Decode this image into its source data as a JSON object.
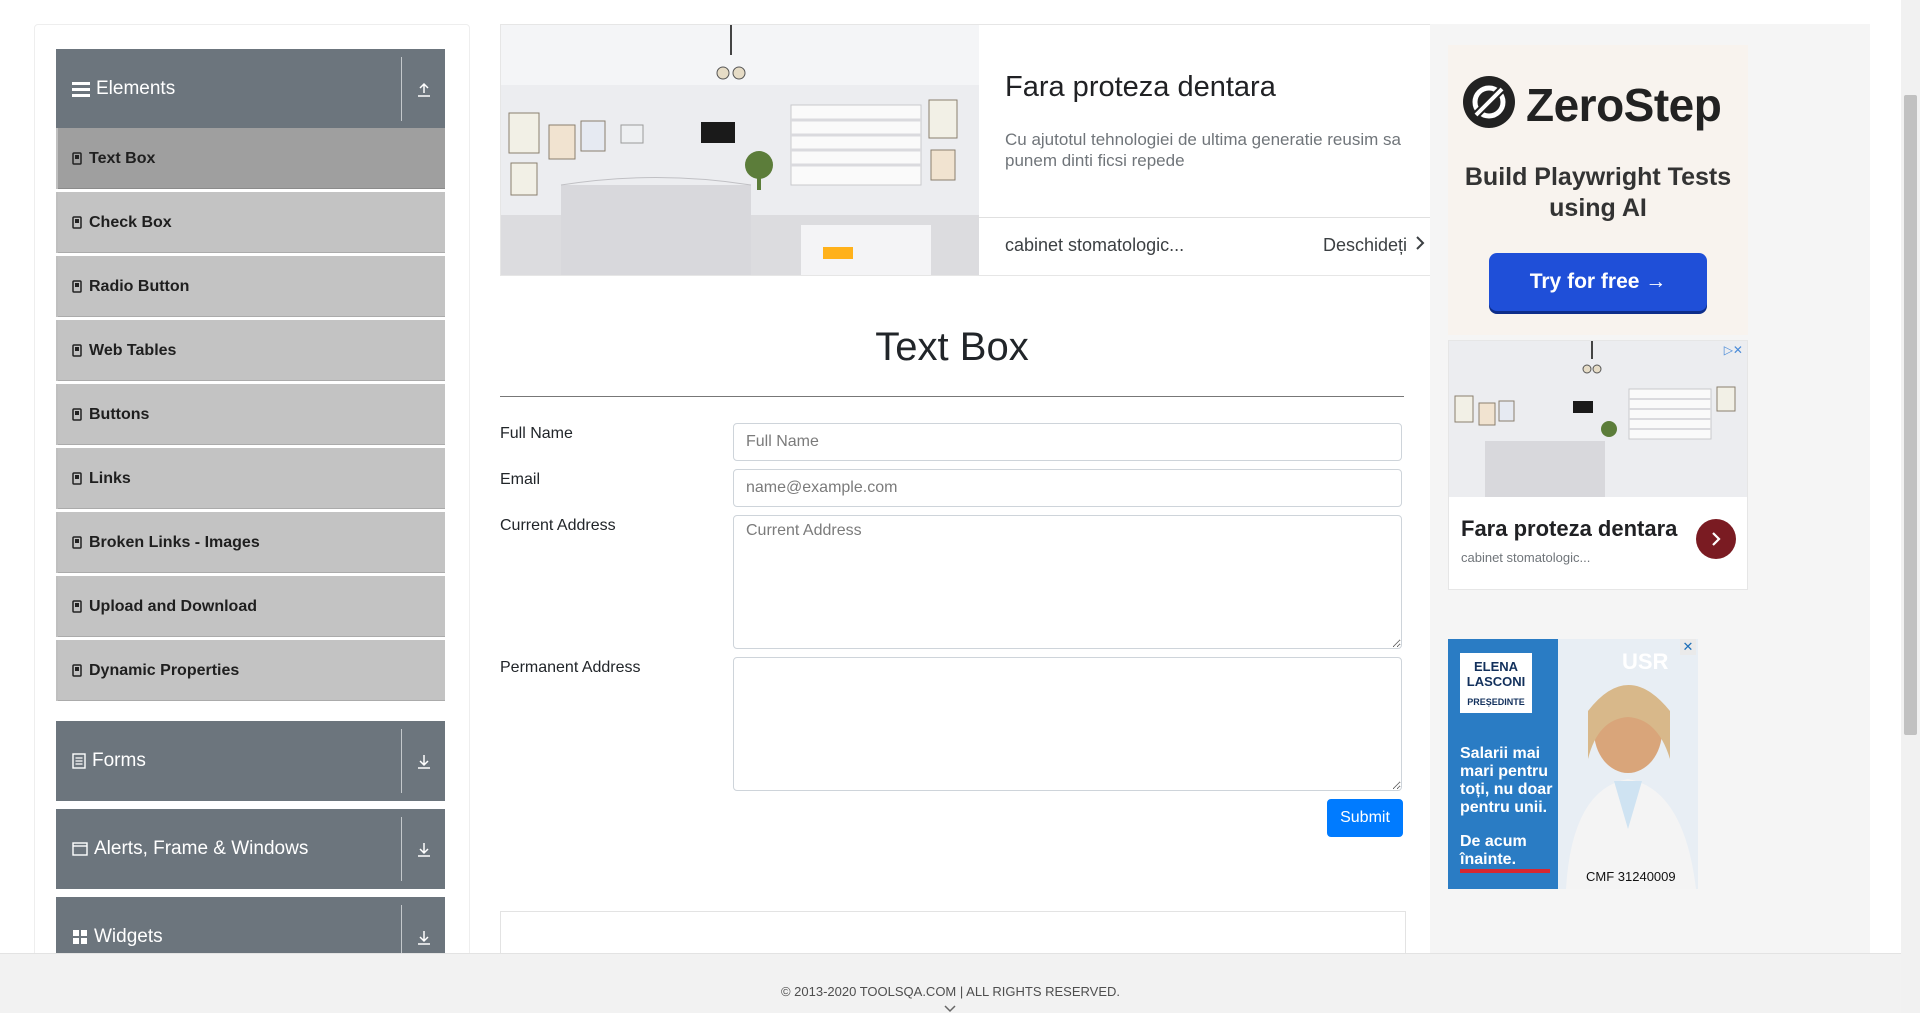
{
  "sidebar": {
    "groups": [
      {
        "label": "Elements",
        "icon": "hamburger-icon",
        "toggle": "collapse-up-icon"
      },
      {
        "label": "Forms",
        "icon": "document-icon",
        "toggle": "expand-down-icon"
      },
      {
        "label": "Alerts, Frame & Windows",
        "icon": "window-icon",
        "toggle": "expand-down-icon"
      },
      {
        "label": "Widgets",
        "icon": "widgets-icon",
        "toggle": "expand-down-icon"
      }
    ],
    "items": [
      {
        "label": "Text Box",
        "active": true
      },
      {
        "label": "Check Box"
      },
      {
        "label": "Radio Button"
      },
      {
        "label": "Web Tables"
      },
      {
        "label": "Buttons"
      },
      {
        "label": "Links"
      },
      {
        "label": "Broken Links - Images"
      },
      {
        "label": "Upload and Download"
      },
      {
        "label": "Dynamic Properties"
      }
    ]
  },
  "ad_banner": {
    "title": "Fara proteza dentara",
    "description": "Cu ajutotul tehnologiei de ultima generatie reusim sa punem dinti ficsi repede",
    "site": "cabinet stomatologic...",
    "open_label": "Deschideți"
  },
  "form": {
    "page_title": "Text Box",
    "full_name": {
      "label": "Full Name",
      "placeholder": "Full Name",
      "value": ""
    },
    "email": {
      "label": "Email",
      "placeholder": "name@example.com",
      "value": ""
    },
    "current_address": {
      "label": "Current Address",
      "placeholder": "Current Address",
      "value": ""
    },
    "permanent_address": {
      "label": "Permanent Address",
      "placeholder": "",
      "value": ""
    },
    "submit_label": "Submit"
  },
  "right_ads": {
    "zerostep": {
      "brand": "ZeroStep",
      "tagline": "Build Playwright Tests using AI",
      "cta": "Try for free →"
    },
    "dental": {
      "title": "Fara proteza dentara",
      "site": "cabinet stomatologic..."
    },
    "usr": {
      "name_line1": "ELENA",
      "name_line2": "LASCONI",
      "role": "PREȘEDINTE",
      "logo": "USR",
      "message": "Salarii mai mari pentru toți, nu doar pentru unii.",
      "cta": "De acum înainte.",
      "cmf": "CMF 31240009"
    }
  },
  "footer": {
    "copyright": "© 2013-2020 TOOLSQA.COM | ALL RIGHTS RESERVED."
  },
  "colors": {
    "sidebar_header": "#6c757d",
    "sidebar_item": "#c3c3c3",
    "sidebar_item_active": "#9f9f9f",
    "submit": "#007bff",
    "zerostep_button": "#1f4fd8"
  }
}
